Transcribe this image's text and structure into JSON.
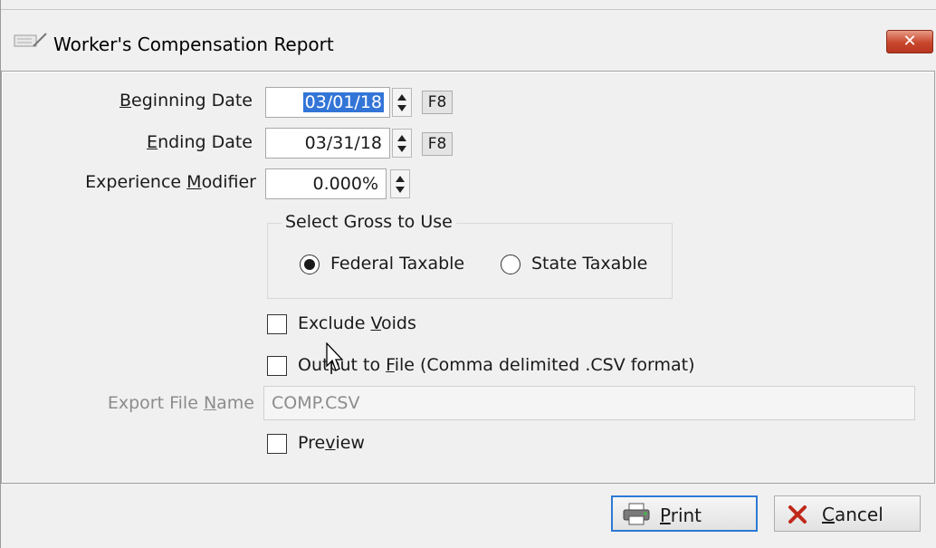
{
  "window": {
    "title": "Worker's Compensation Report",
    "close_label": "✕"
  },
  "fields": {
    "beginning_date": {
      "label_pre": "",
      "label_ul": "B",
      "label_post": "eginning Date",
      "value": "03/01/18",
      "fkey": "F8"
    },
    "ending_date": {
      "label_pre": "",
      "label_ul": "E",
      "label_post": "nding Date",
      "value": "03/31/18",
      "fkey": "F8"
    },
    "experience_modifier": {
      "label_pre": "Experience ",
      "label_ul": "M",
      "label_post": "odifier",
      "value": "0.000%"
    }
  },
  "gross_group": {
    "title": "Select Gross to Use",
    "options": [
      {
        "label": "Federal Taxable",
        "selected": true
      },
      {
        "label": "State Taxable",
        "selected": false
      }
    ]
  },
  "checkboxes": {
    "exclude_voids": {
      "pre": "Exclude ",
      "ul": "V",
      "post": "oids",
      "checked": false
    },
    "output_to_file": {
      "pre": "Output to ",
      "ul": "F",
      "post": "ile (Comma delimited .CSV format)",
      "checked": false
    },
    "preview": {
      "pre": "Pre",
      "ul": "v",
      "post": "iew",
      "checked": false
    }
  },
  "export": {
    "label_pre": "Export File ",
    "label_ul": "N",
    "label_post": "ame",
    "value": "COMP.CSV"
  },
  "buttons": {
    "print": {
      "ul": "P",
      "post": "rint"
    },
    "cancel": {
      "ul": "C",
      "post": "ancel"
    }
  },
  "colors": {
    "selection": "#3375d7",
    "default_button_border": "#2b7ad4",
    "close_button": "#c8462c",
    "cancel_icon": "#c0281a"
  }
}
